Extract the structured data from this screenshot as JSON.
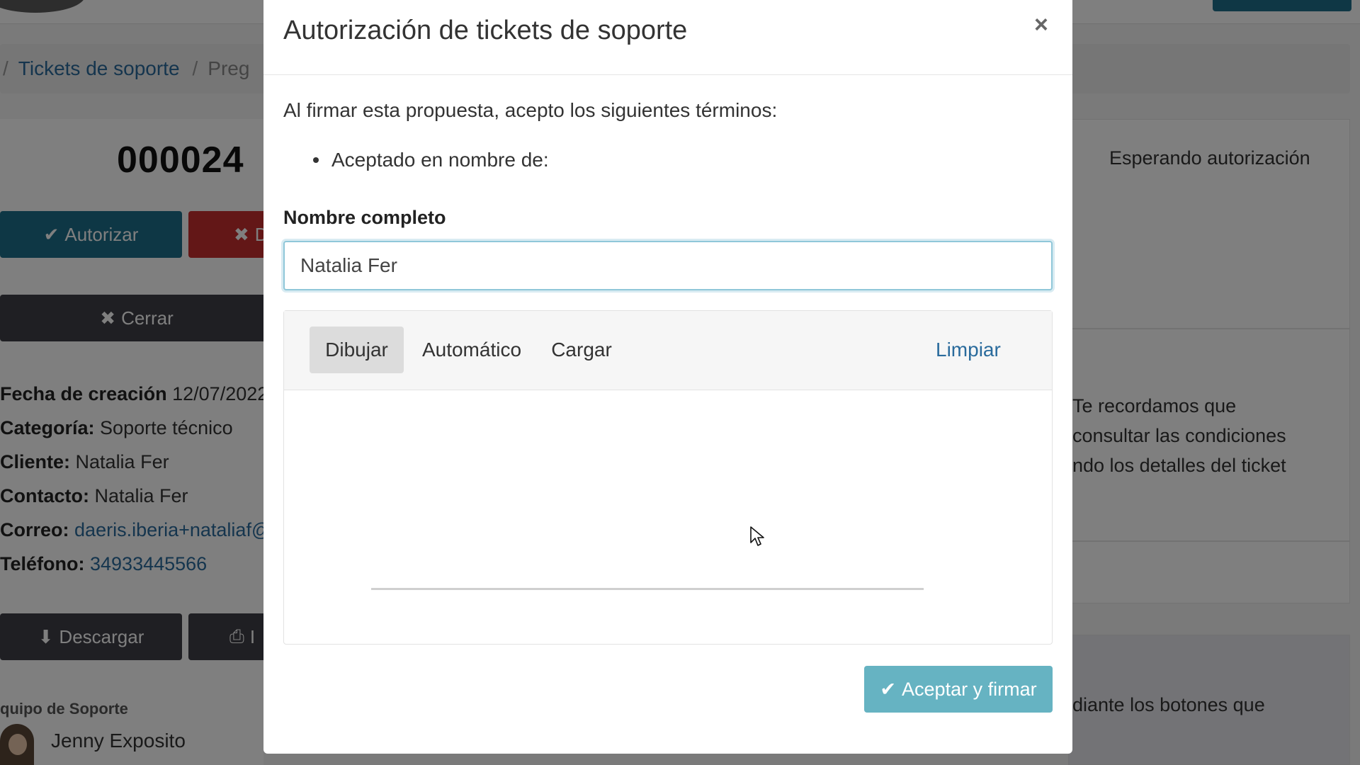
{
  "background": {
    "breadcrumb": {
      "items": [
        "Tickets de soporte",
        "Preg"
      ]
    },
    "ticket": {
      "number": "000024",
      "status": "Esperando autorización",
      "buttons": {
        "authorize": "Autorizar",
        "deny": "D",
        "close": "Cerrar",
        "download": "Descargar",
        "print": "I"
      },
      "info": {
        "created_label": "Fecha de creación",
        "created_value": "12/07/2022",
        "category_label": "Categoría:",
        "category_value": "Soporte técnico",
        "client_label": "Cliente:",
        "client_value": "Natalia Fer",
        "contact_label": "Contacto:",
        "contact_value": "Natalia Fer",
        "email_label": "Correo:",
        "email_value": "daeris.iberia+nataliaf@",
        "phone_label": "Teléfono:",
        "phone_value": "34933445566"
      },
      "team": {
        "label": "quipo de Soporte",
        "member": "Jenny Exposito"
      },
      "notice_lines": [
        "Te recordamos que",
        "consultar las condiciones",
        "ndo los detalles del ticket"
      ],
      "footer_line": "diante los botones que"
    }
  },
  "modal": {
    "title": "Autorización de tickets de soporte",
    "close_symbol": "×",
    "terms_intro": "Al firmar esta propuesta, acepto los siguientes términos:",
    "bullet": "Aceptado en nombre de:",
    "name_label": "Nombre completo",
    "name_value": "Natalia Fer",
    "signature": {
      "tabs": [
        "Dibujar",
        "Automático",
        "Cargar"
      ],
      "active_tab": "Dibujar",
      "clear": "Limpiar"
    },
    "accept_button": "Aceptar y firmar"
  },
  "colors": {
    "primary": "#1d6f8a",
    "danger": "#c72e2e",
    "dark": "#3e3e46",
    "link": "#2a6b9c",
    "accept": "#66b3c2"
  },
  "icons": {
    "check": "check-icon",
    "times": "times-icon",
    "download": "download-icon",
    "print": "print-icon",
    "cursor": "mouse-cursor-icon"
  }
}
